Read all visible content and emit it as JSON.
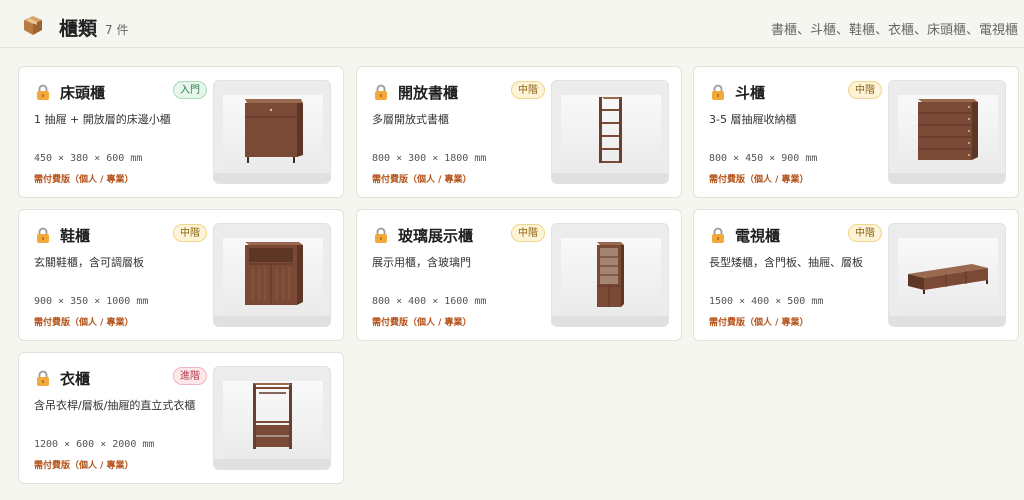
{
  "header": {
    "title": "櫃類",
    "count": "7 件",
    "categories": "書櫃、斗櫃、鞋櫃、衣櫃、床頭櫃、電視櫃"
  },
  "colors": {
    "wood": "#7a4a36",
    "wood_dark": "#5e3626",
    "paid_text": "#b5541c"
  },
  "cards": [
    {
      "name": "床頭櫃",
      "badge": "入門",
      "badge_level": "entry",
      "desc": "1 抽屜 + 開放層的床邊小櫃",
      "dims": "450 × 380 × 600 mm",
      "paid": "需付費版（個人 / 專業）",
      "icon": "lock-icon"
    },
    {
      "name": "開放書櫃",
      "badge": "中階",
      "badge_level": "mid",
      "desc": "多層開放式書櫃",
      "dims": "800 × 300 × 1800 mm",
      "paid": "需付費版（個人 / 專業）",
      "icon": "lock-icon"
    },
    {
      "name": "斗櫃",
      "badge": "中階",
      "badge_level": "mid",
      "desc": "3-5 層抽屜收納櫃",
      "dims": "800 × 450 × 900 mm",
      "paid": "需付費版（個人 / 專業）",
      "icon": "lock-icon"
    },
    {
      "name": "鞋櫃",
      "badge": "中階",
      "badge_level": "mid",
      "desc": "玄關鞋櫃，含可調層板",
      "dims": "900 × 350 × 1000 mm",
      "paid": "需付費版（個人 / 專業）",
      "icon": "lock-icon"
    },
    {
      "name": "玻璃展示櫃",
      "badge": "中階",
      "badge_level": "mid",
      "desc": "展示用櫃，含玻璃門",
      "dims": "800 × 400 × 1600 mm",
      "paid": "需付費版（個人 / 專業）",
      "icon": "lock-icon"
    },
    {
      "name": "電視櫃",
      "badge": "中階",
      "badge_level": "mid",
      "desc": "長型矮櫃，含門板、抽屜、層板",
      "dims": "1500 × 400 × 500 mm",
      "paid": "需付費版（個人 / 專業）",
      "icon": "lock-icon"
    },
    {
      "name": "衣櫃",
      "badge": "進階",
      "badge_level": "adv",
      "desc": "含吊衣桿/層板/抽屜的直立式衣櫃",
      "dims": "1200 × 600 × 2000 mm",
      "paid": "需付費版（個人 / 專業）",
      "icon": "lock-icon"
    }
  ]
}
